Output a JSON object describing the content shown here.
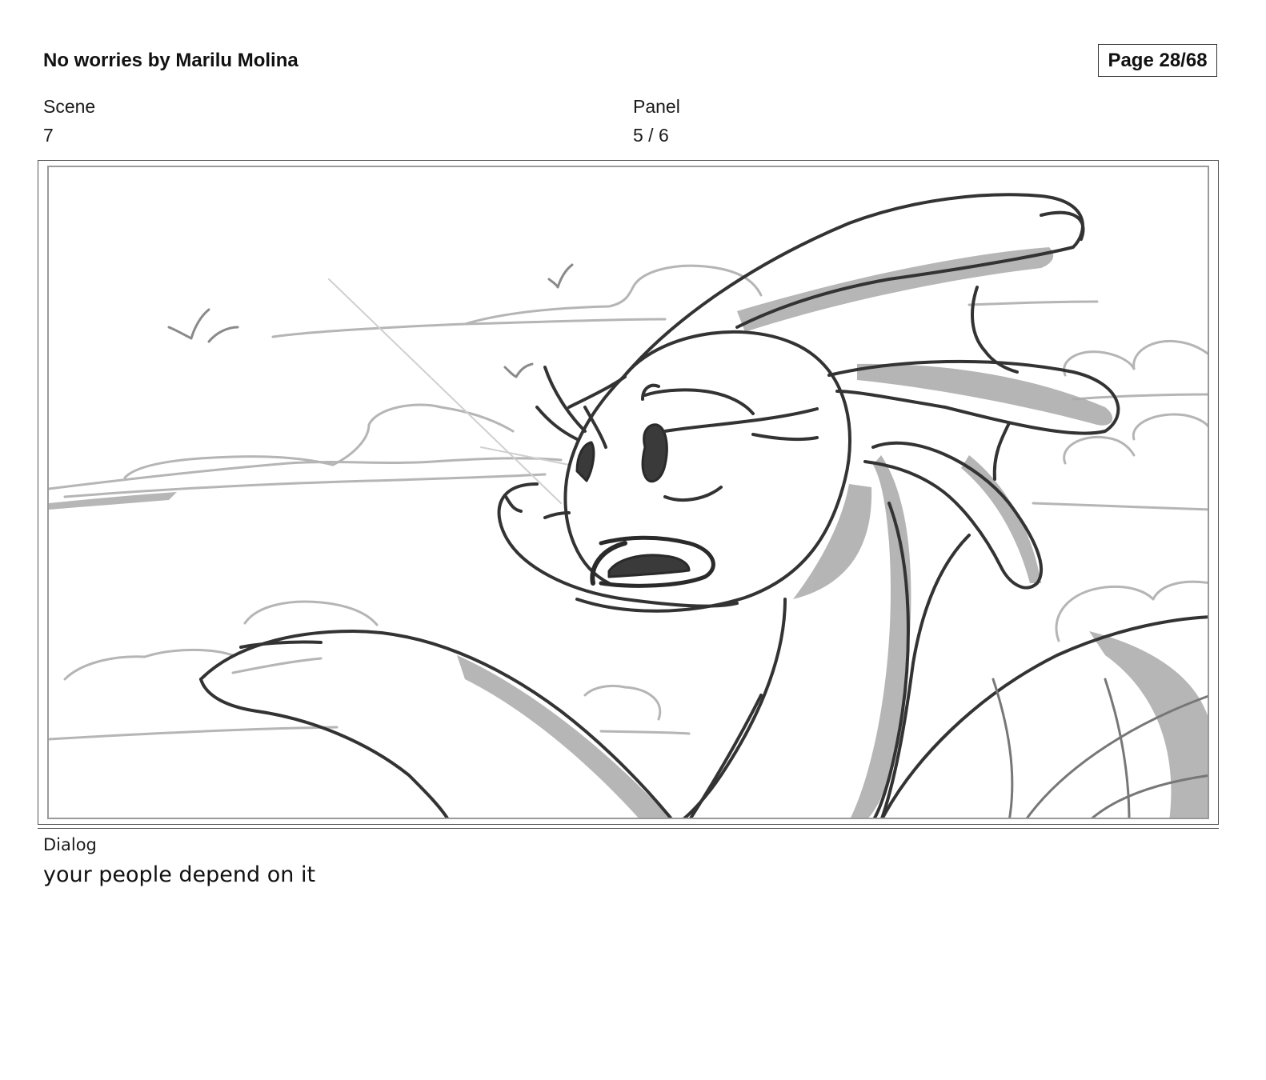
{
  "header": {
    "title": "No worries by Marilu Molina",
    "page_indicator": "Page 28/68"
  },
  "fields": {
    "scene_label": "Scene",
    "scene_value": "7",
    "panel_label": "Panel",
    "panel_value": "5 / 6"
  },
  "dialog": {
    "label": "Dialog",
    "text": "your people depend on it"
  }
}
